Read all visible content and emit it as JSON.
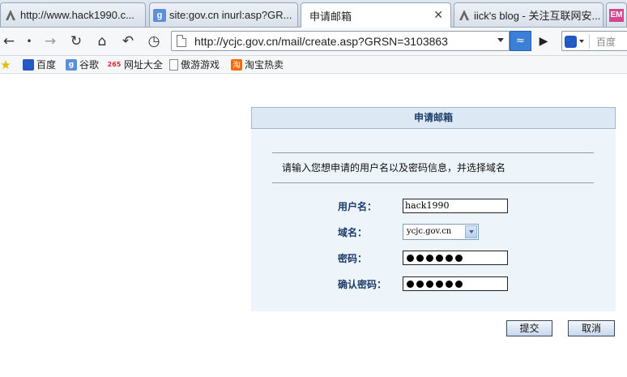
{
  "browser": {
    "tabs": [
      {
        "label": "http://www.hack1990.c...",
        "icon": "a-logo-icon"
      },
      {
        "label": "site:gov.cn inurl:asp?GR...",
        "icon": "google-icon"
      },
      {
        "label": "申请邮箱",
        "icon": "",
        "active": true
      },
      {
        "label": "iick's blog - 关注互联网安...",
        "icon": "a-logo-icon"
      },
      {
        "label": "EM",
        "icon": "em-icon"
      }
    ],
    "address": "http://ycjc.gov.cn/mail/create.asp?GRSN=3103863",
    "search_placeholder": "百度",
    "search_engine_glyph": "🐾",
    "bookmarks": [
      {
        "label": "百度",
        "icon": "baidu-icon",
        "glyph": "🐾"
      },
      {
        "label": "谷歌",
        "icon": "google-icon",
        "glyph": "g"
      },
      {
        "label": "网址大全",
        "icon": "265-icon",
        "glyph": "265"
      },
      {
        "label": "傲游游戏",
        "icon": "page-icon",
        "glyph": ""
      },
      {
        "label": "淘宝热卖",
        "icon": "taobao-icon",
        "glyph": "淘"
      }
    ]
  },
  "form": {
    "title": "申请邮箱",
    "intro": "请输入您想申请的用户名以及密码信息，并选择域名",
    "username_label": "用户名：",
    "username_value": "hack1990",
    "domain_label": "域名：",
    "domain_value": "ycjc.gov.cn",
    "password_label": "密码：",
    "password_dots": 6,
    "confirm_label": "确认密码：",
    "confirm_dots": 6,
    "submit_label": "提交",
    "cancel_label": "取消"
  }
}
